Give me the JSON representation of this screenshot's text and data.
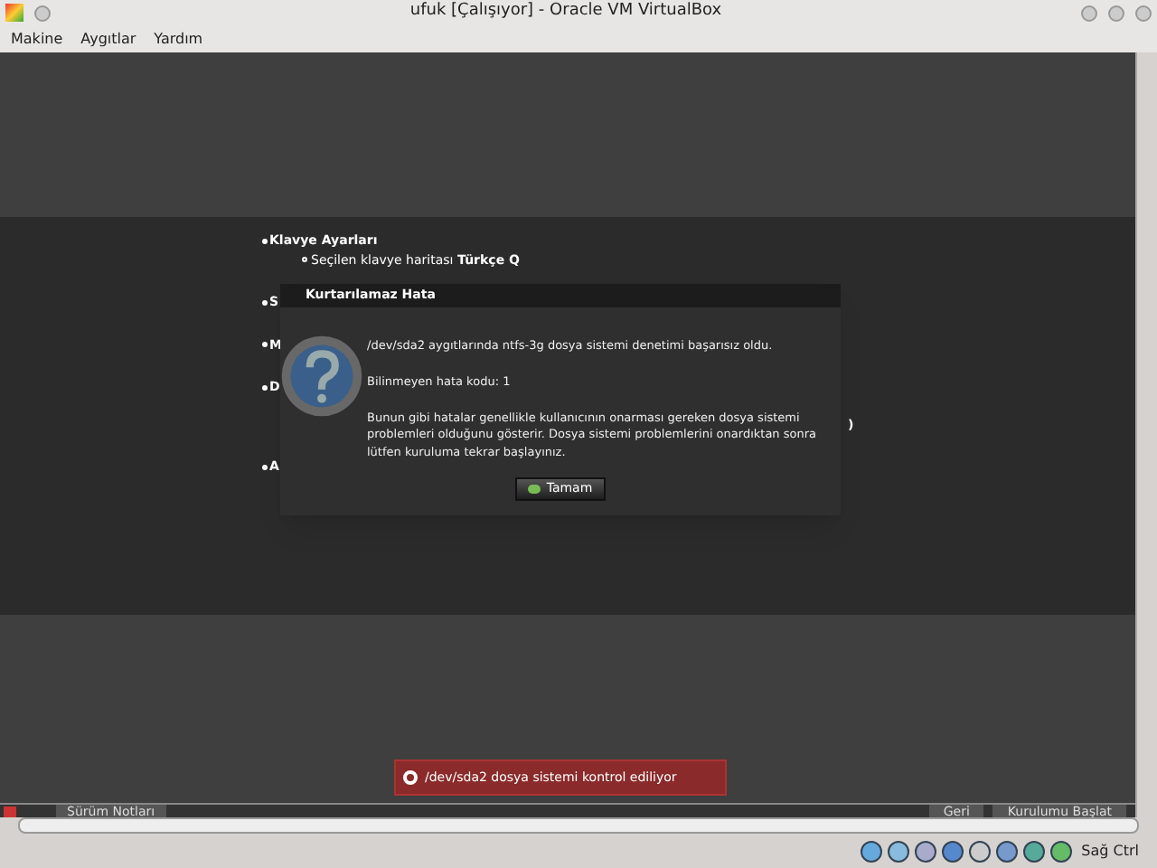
{
  "window": {
    "title": "ufuk [Çalışıyor] - Oracle VM VirtualBox"
  },
  "menu": [
    "Makine",
    "Aygıtlar",
    "Yardım"
  ],
  "settings": [
    {
      "title": "Klavye Ayarları",
      "children": [
        "Seçilen klavye haritası **Türkçe Q**"
      ]
    },
    {
      "title": "S"
    },
    {
      "title": "M"
    },
    {
      "title": "D",
      "tail": ")"
    },
    {
      "title": "A"
    }
  ],
  "dialog": {
    "title": "Kurtarılamaz Hata",
    "messages": [
      "/dev/sda2 aygıtlarında ntfs-3g dosya sistemi denetimi başarısız oldu.",
      "Bilinmeyen hata kodu: 1",
      "Bunun gibi hatalar genellikle kullanıcının onarması gereken dosya sistemi problemleri olduğunu gösterir. Dosya sistemi problemlerini onardıktan sonra lütfen kuruluma tekrar başlayınız."
    ],
    "button": "Tamam"
  },
  "notification": "/dev/sda2 dosya sistemi kontrol ediliyor",
  "footer": {
    "left_button": "Sürüm Notları",
    "buttons": [
      "Geri",
      "Kurulumu Başlat"
    ]
  },
  "status_bar": {
    "host_key": "Sağ Ctrl"
  }
}
